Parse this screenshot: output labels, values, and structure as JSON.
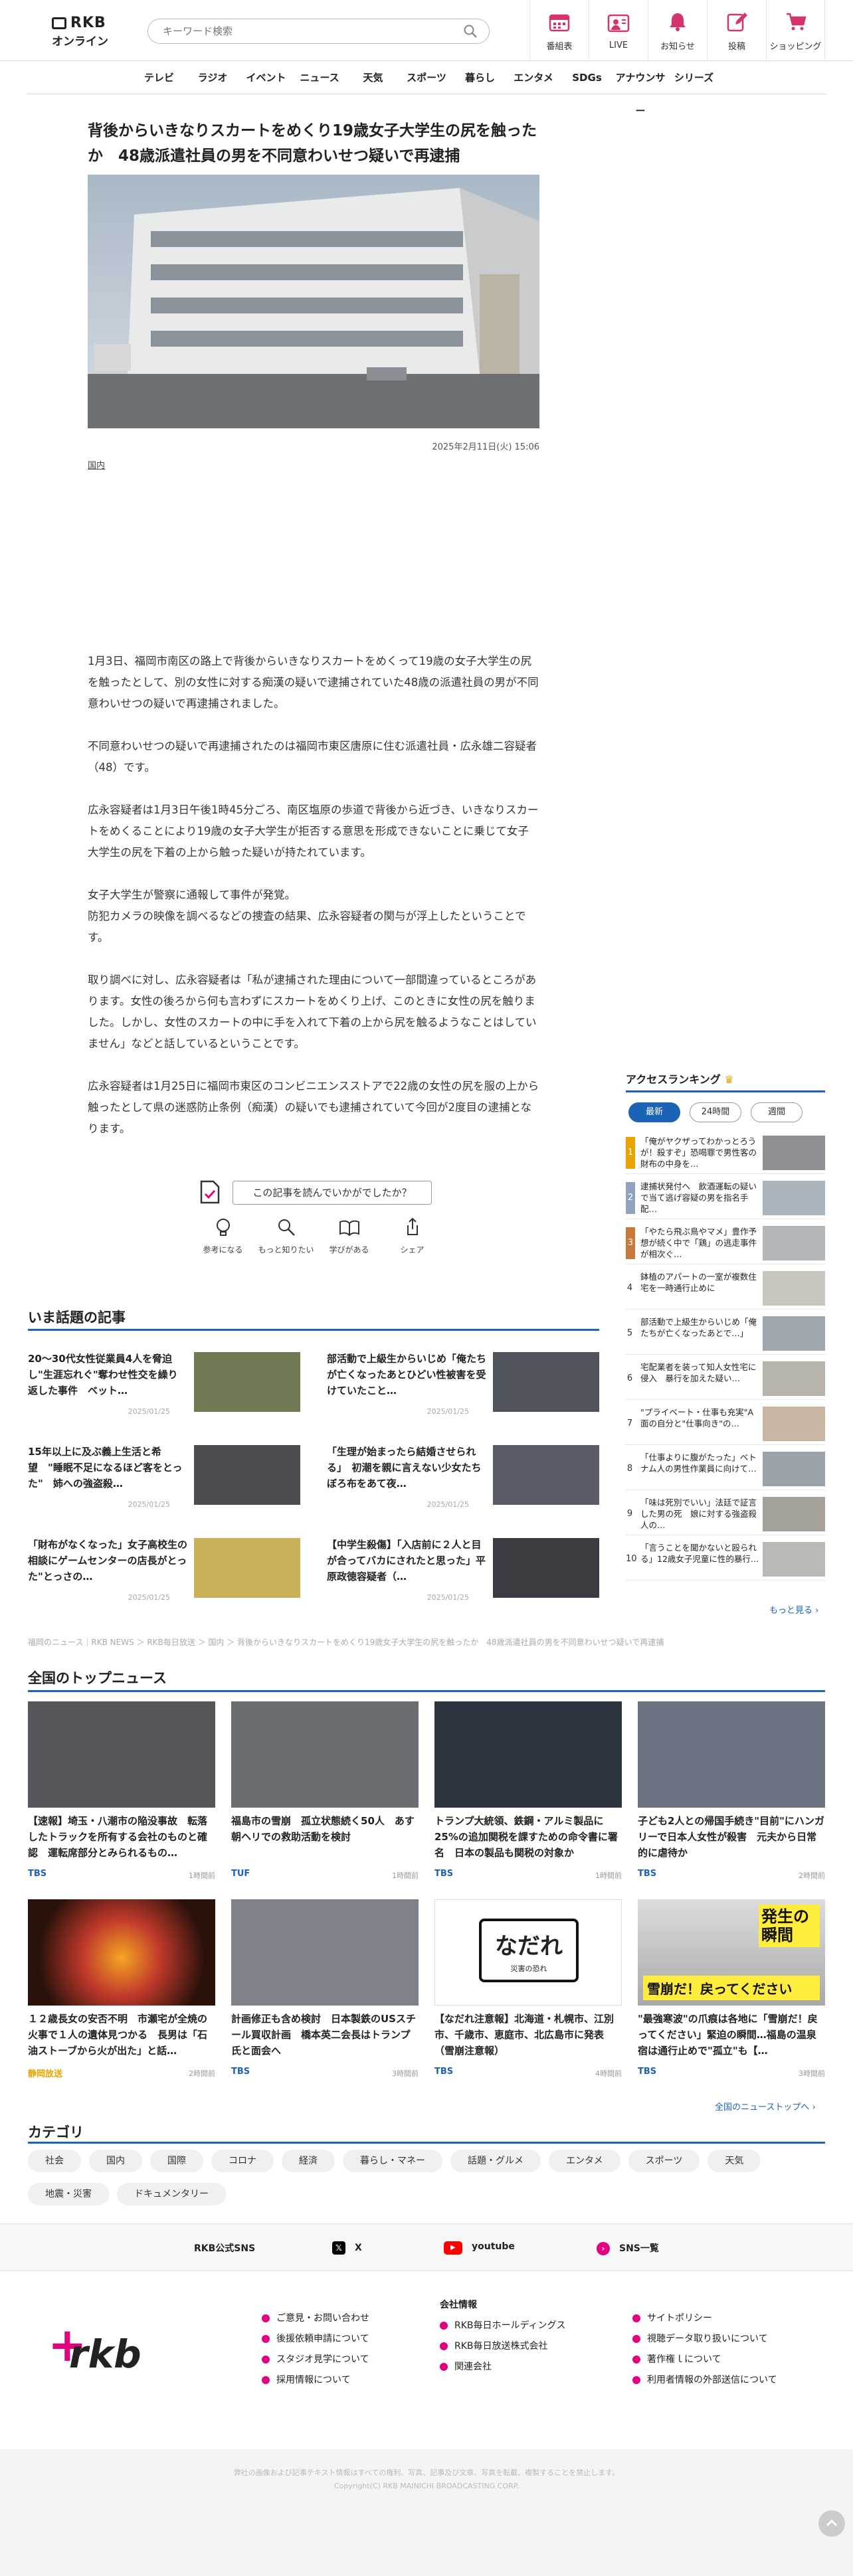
{
  "header": {
    "logo_line1": "RKB",
    "logo_line2": "オンライン",
    "search_placeholder": "キーワード検索",
    "nav": [
      {
        "label": "番組表",
        "icon": "calendar-icon"
      },
      {
        "label": "LIVE",
        "icon": "live-icon"
      },
      {
        "label": "お知らせ",
        "icon": "bell-icon"
      },
      {
        "label": "投稿",
        "icon": "edit-icon"
      },
      {
        "label": "ショッピング",
        "icon": "cart-icon"
      }
    ],
    "accent": "#e4007f"
  },
  "global_nav": [
    "テレビ",
    "ラジオ",
    "イベント",
    "ニュース",
    "天気",
    "スポーツ",
    "暮らし",
    "エンタメ",
    "SDGs",
    "アナウンサー",
    "シリーズ"
  ],
  "article": {
    "title": "背後からいきなりスカートをめくり19歳女子大学生の尻を触ったか　48歳派遣社員の男を不同意わいせつ疑いで再逮捕",
    "image_caption_date": "2025年2月11日(火) 15:06",
    "category": "国内",
    "paragraphs": [
      "1月3日、福岡市南区の路上で背後からいきなりスカートをめくって19歳の女子大学生の尻を触ったとして、別の女性に対する痴漢の疑いで逮捕されていた48歳の派遣社員の男が不同意わいせつの疑いで再逮捕されました。",
      "不同意わいせつの疑いで再逮捕されたのは福岡市東区唐原に住む派遣社員・広永雄二容疑者（48）です。",
      "広永容疑者は1月3日午後1時45分ごろ、南区塩原の歩道で背後から近づき、いきなりスカートをめくることにより19歳の女子大学生が拒否する意思を形成できないことに乗じて女子大学生の尻を下着の上から触った疑いが持たれています。",
      "女子大学生が警察に通報して事件が発覚。\n防犯カメラの映像を調べるなどの捜査の結果、広永容疑者の関与が浮上したということです。",
      "取り調べに対し、広永容疑者は「私が逮捕された理由について一部間違っているところがあります。女性の後ろから何も言わずにスカートをめくり上げ、このときに女性の尻を触りました。しかし、女性のスカートの中に手を入れて下着の上から尻を触るようなことはしていません」などと話しているということです。",
      "広永容疑者は1月25日に福岡市東区のコンビニエンスストアで22歳の女性の尻を服の上から触ったとして県の迷惑防止条例（痴漢）の疑いでも逮捕されていて今回が2度目の逮捕となります。"
    ],
    "feedback_button": "この記事を読んでいかがでしたか？",
    "reactions": [
      "参考になる",
      "もっと知りたい",
      "学びがある",
      "シェア"
    ]
  },
  "ranking": {
    "title": "アクセスランキング",
    "tabs": [
      "最新",
      "24時間",
      "週間"
    ],
    "items": [
      {
        "no": "1",
        "text": "「俺がヤクザってわかっとろうが！殺すぞ」恐喝罪で男性客の財布の中身を…"
      },
      {
        "no": "2",
        "text": "逮捕状発付へ　飲酒運転の疑いで当て逃げ容疑の男を指名手配…"
      },
      {
        "no": "3",
        "text": "「やたら飛ぶ鳥やマメ」豊作予想が続く中で「鶏」の逃走事件が相次ぐ…"
      },
      {
        "no": "4",
        "text": "鉢植のアパートの一室が複数住宅を一時通行止めに"
      },
      {
        "no": "5",
        "text": "部活動で上級生からいじめ「俺たちが亡くなったあとで…」"
      },
      {
        "no": "6",
        "text": "宅配業者を装って知人女性宅に侵入　暴行を加えた疑い…"
      },
      {
        "no": "7",
        "text": "\"プライベート・仕事も充実\"A面の自分と\"仕事向き\"の…"
      },
      {
        "no": "8",
        "text": "「仕事よりに腹がたった」ベトナム人の男性作業員に向けて…"
      },
      {
        "no": "9",
        "text": "「味は死別でいい」法廷で証言した男の死　娘に対する強盗殺人の…"
      },
      {
        "no": "10",
        "text": "「言うことを聞かないと殴られる」12歳女子児童に性的暴行…"
      }
    ],
    "more": "もっと見る"
  },
  "hot_topics": {
    "title": "いま話題の記事",
    "items": [
      {
        "text": "20〜30代女性従業員4人を脅迫し\"生涯忘れぐ\"奪わせ性交を繰り返した事件　ベット…",
        "date": "2025/01/25"
      },
      {
        "text": "部活動で上級生からいじめ「俺たちが亡くなったあとひどい性被害を受けていたこと…",
        "date": "2025/01/25"
      },
      {
        "text": "15年以上に及ぶ義上生活と希望　\"睡眠不足になるほど客をとった\"　姉への強盗殺…",
        "date": "2025/01/25"
      },
      {
        "text": "「生理が始まったら結婚させられる」　初潮を親に言えない少女たち　ぼろ布をあて夜…",
        "date": "2025/01/25"
      },
      {
        "text": "「財布がなくなった」女子高校生の相談にゲームセンターの店長がとった\"とっさの…",
        "date": "2025/01/25"
      },
      {
        "text": "【中学生殺傷】「入店前に２人と目が合ってバカにされたと思った」平原政徳容疑者（…",
        "date": "2025/01/25"
      }
    ]
  },
  "breadcrumb": "福岡のニュース｜RKB NEWS ＞ RKB毎日放送 ＞ 国内 ＞ 背後からいきなりスカートをめくり19歳女子大学生の尻を触ったか　48歳派遣社員の男を不同意わいせつ疑いで再逮捕",
  "national": {
    "title": "全国のトップニュース",
    "items": [
      {
        "text": "【速報】埼玉・八潮市の陥没事故　転落したトラックを所有する会社のものと確認　運転席部分とみられるもの…",
        "src": "TBS",
        "ago": "1時間前",
        "src_color": "#1a63b5"
      },
      {
        "text": "福島市の雪崩　孤立状態続く50人　あす朝ヘリでの救助活動を検討",
        "src": "TUF",
        "ago": "1時間前",
        "src_color": "#1a63b5"
      },
      {
        "text": "トランプ大統領、鉄鋼・アルミ製品に25%の追加関税を課すための命令書に署名　日本の製品も関税の対象か",
        "src": "TBS",
        "ago": "1時間前",
        "src_color": "#1a63b5"
      },
      {
        "text": "子ども2人との帰国手続き\"目前\"にハンガリーで日本人女性が殺害　元夫から日常的に虐待か",
        "src": "TBS",
        "ago": "2時間前",
        "src_color": "#1a63b5"
      },
      {
        "text": "１２歳長女の安否不明　市瀬宅が全焼の火事で１人の遺体見つかる　長男は「石油ストーブから火が出た」と話…",
        "src": "静岡放送",
        "ago": "2時間前",
        "src_color": "#e8a400"
      },
      {
        "text": "計画修正も含め検討　日本製鉄のUSスチール買収計画　橋本英二会長はトランプ氏と面会へ",
        "src": "TBS",
        "ago": "3時間前",
        "src_color": "#1a63b5"
      },
      {
        "text": "【なだれ注意報】北海道・札幌市、江別市、千歳市、恵庭市、北広島市に発表（雪崩注意報）",
        "src": "TBS",
        "ago": "4時間前",
        "src_color": "#1a63b5"
      },
      {
        "text": "\"最強寒波\"の爪痕は各地に「雪崩だ！戻ってください」緊迫の瞬間…福島の温泉宿は通行止めで\"孤立\"も【…",
        "src": "TBS",
        "ago": "3時間前",
        "src_color": "#1a63b5"
      }
    ],
    "more": "全国のニューストップへ",
    "img_texts": {
      "nadare": "なだれ",
      "nadare_sub": "災害の恐れ",
      "ss_badge": "発生の瞬間",
      "ss_cap": "雪崩だ！戻ってください"
    }
  },
  "categories": {
    "title": "カテゴリ",
    "items": [
      "社会",
      "国内",
      "国際",
      "コロナ",
      "経済",
      "暮らし・マネー",
      "話題・グルメ",
      "エンタメ",
      "スポーツ",
      "天気",
      "地震・災害",
      "ドキュメンタリー"
    ]
  },
  "sns": {
    "label": "RKB公式SNS",
    "x": "X",
    "youtube": "youtube",
    "list": "SNS一覧"
  },
  "footer": {
    "logo": "rkb",
    "col1": [
      "ご意見・お問い合わせ",
      "後援依頼申請について",
      "スタジオ見学について",
      "採用情報について"
    ],
    "col2_title": "会社情報",
    "col2": [
      "RKB毎日ホールディングス",
      "RKB毎日放送株式会社",
      "関連会社"
    ],
    "col3": [
      "サイトポリシー",
      "視聴データ取り扱いについて",
      "著作権ｌについて",
      "利用者情報の外部送信について"
    ],
    "copy1": "弊社の画像および記事テキスト情報はすべての権利、写真、記事及び文章、写真を転載、複製することを禁止します。",
    "copy2": "Copyright(C) RKB MAINICHI BROADCASTING CORP."
  }
}
